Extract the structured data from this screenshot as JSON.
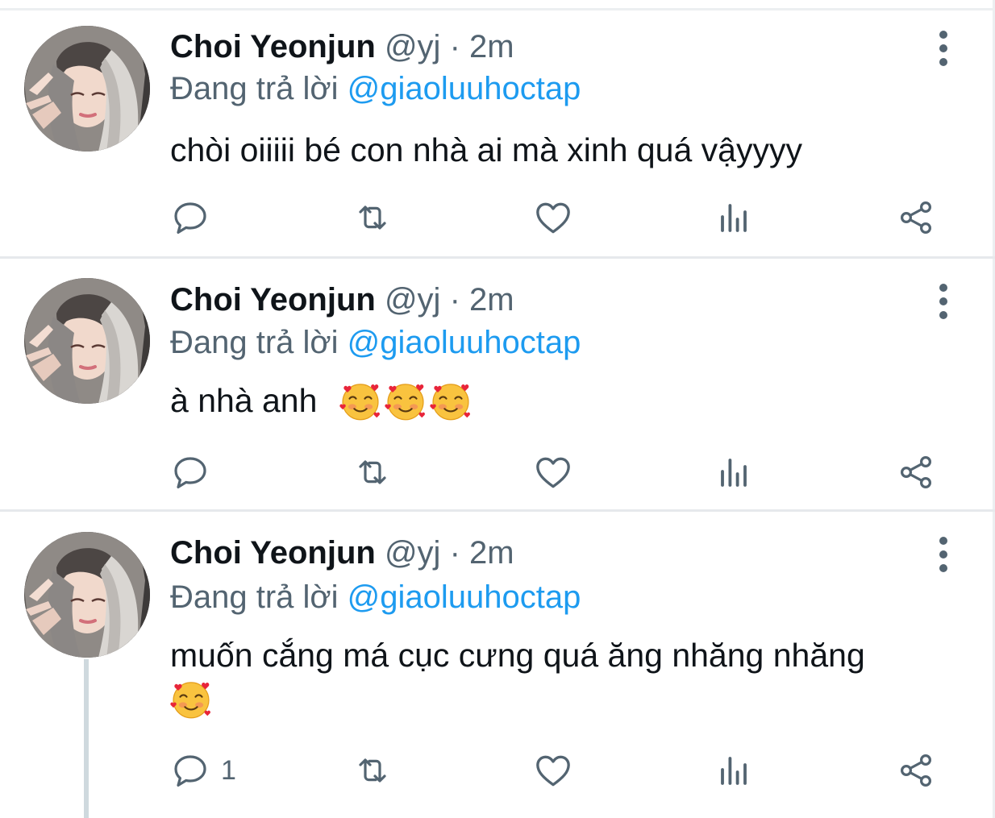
{
  "colors": {
    "text": "#0f1419",
    "secondary": "#536471",
    "mention": "#1d9bf0",
    "divider": "#e6e9ec"
  },
  "tweets": [
    {
      "author": {
        "name": "Choi Yeonjun",
        "handle": "@yj",
        "separator": "·",
        "time": "2m"
      },
      "reply_prefix": "Đang trả lời",
      "reply_to": "@giaoluuhoctap",
      "text": "chòi oiiiii bé con nhà ai mà xinh quá vậyyyy",
      "emojis": [],
      "reply_count": "",
      "icons": [
        "reply-icon",
        "retweet-icon",
        "like-icon",
        "analytics-icon",
        "share-icon"
      ]
    },
    {
      "author": {
        "name": "Choi Yeonjun",
        "handle": "@yj",
        "separator": "·",
        "time": "2m"
      },
      "reply_prefix": "Đang trả lời",
      "reply_to": "@giaoluuhoctap",
      "text": "à nhà anh",
      "emojis": [
        "smiling-face-with-hearts-emoji",
        "smiling-face-with-hearts-emoji",
        "smiling-face-with-hearts-emoji"
      ],
      "reply_count": "",
      "icons": [
        "reply-icon",
        "retweet-icon",
        "like-icon",
        "analytics-icon",
        "share-icon"
      ]
    },
    {
      "author": {
        "name": "Choi Yeonjun",
        "handle": "@yj",
        "separator": "·",
        "time": "2m"
      },
      "reply_prefix": "Đang trả lời",
      "reply_to": "@giaoluuhoctap",
      "text": "muốn cắng má cục cưng quá ăng nhăng nhăng",
      "emojis": [
        "smiling-face-with-hearts-emoji"
      ],
      "reply_count": "1",
      "icons": [
        "reply-icon",
        "retweet-icon",
        "like-icon",
        "analytics-icon",
        "share-icon"
      ]
    }
  ]
}
